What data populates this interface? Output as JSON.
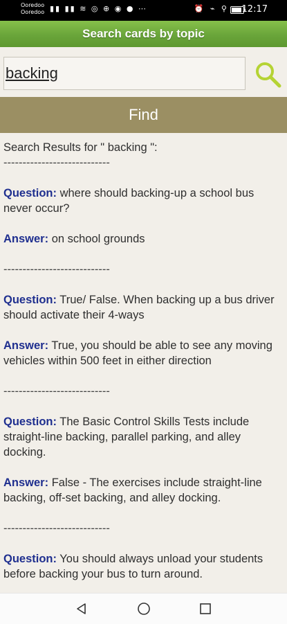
{
  "statusbar": {
    "carrier1": "Ooredoo",
    "carrier2": "Ooredoo",
    "time": "12:17"
  },
  "title": "Search cards by topic",
  "search": {
    "value": "backing"
  },
  "find_label": "Find",
  "results": {
    "header": "Search Results for \" backing \":",
    "divider": "----------------------------",
    "question_label": "Question:",
    "answer_label": "Answer:",
    "items": [
      {
        "question": " where should backing-up a school bus never occur?",
        "answer": " on school grounds"
      },
      {
        "question": " True/ False. When backing up a bus driver should activate their 4-ways",
        "answer": " True, you should be able to see any moving vehicles within 500 feet in either direction"
      },
      {
        "question": " The Basic Control Skills Tests include straight-line backing, parallel parking, and alley docking.",
        "answer": " False - The exercises include straight-line backing, off-set backing, and alley docking."
      },
      {
        "question": " You should always unload your students before backing your bus to turn around."
      }
    ]
  },
  "colors": {
    "title_green": "#6aa53a",
    "find_bar": "#9b8f63",
    "label_blue": "#1f2f8f",
    "search_icon": "#b5d334"
  },
  "icons": {
    "search": "search-icon",
    "back": "back-triangle-icon",
    "home": "home-circle-icon",
    "recent": "recent-square-icon"
  }
}
